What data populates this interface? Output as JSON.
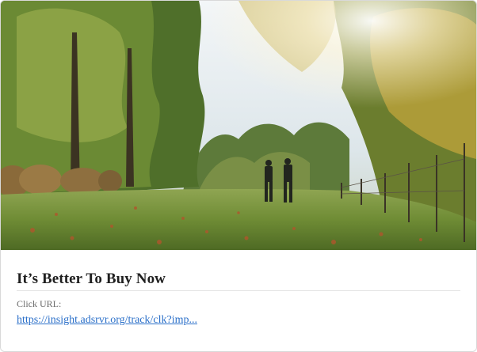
{
  "ad": {
    "image_description_icon": "landscape-photo",
    "headline": "It’s Better To Buy Now",
    "click_url_label": "Click URL:",
    "click_url": "https://insight.adsrvr.org/track/clk?imp..."
  },
  "colors": {
    "headline": "#1f1f1f",
    "label": "#6b6b6b",
    "link": "#2a6fc9",
    "border": "#d9d9d9"
  }
}
